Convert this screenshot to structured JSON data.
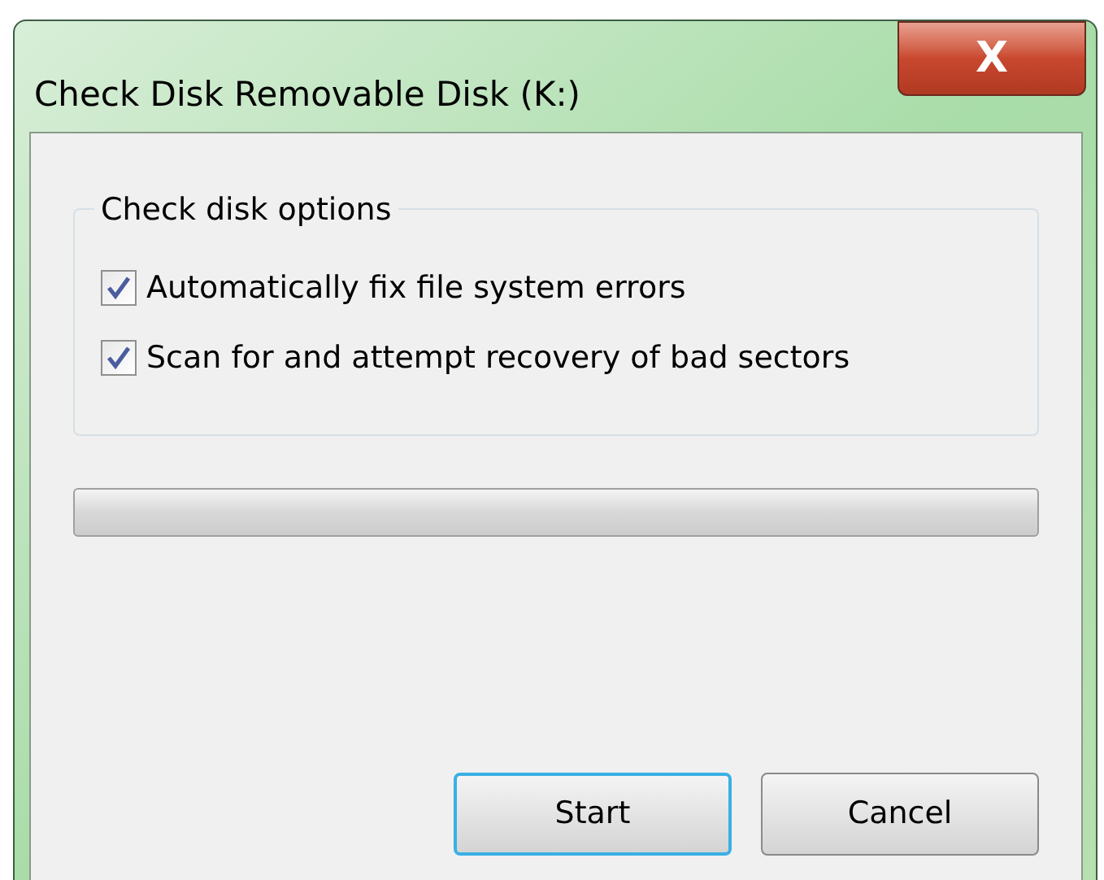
{
  "window": {
    "title": "Check Disk Removable Disk (K:)",
    "close": "X"
  },
  "options": {
    "title": "Check disk options",
    "items": [
      {
        "label": "Automatically fix file system errors",
        "checked": true
      },
      {
        "label": "Scan for and attempt recovery of bad sectors",
        "checked": true
      }
    ]
  },
  "progress": {
    "level": 0
  },
  "buttons": [
    {
      "label": "Start",
      "default": true
    },
    {
      "label": "Cancel",
      "default": false
    }
  ]
}
